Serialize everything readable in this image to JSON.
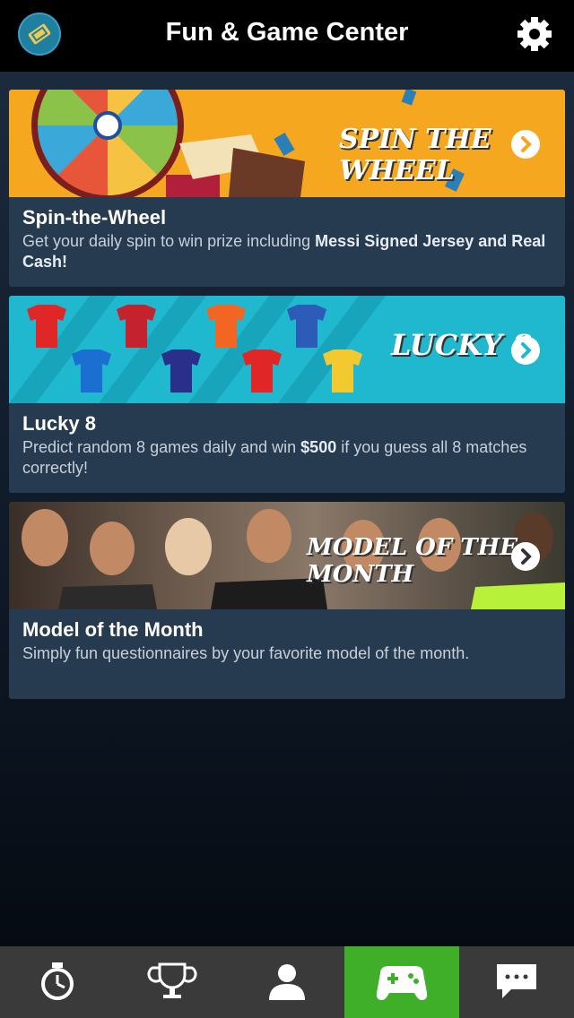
{
  "header": {
    "title": "Fun & Game Center",
    "logo_icon": "ticket-logo-icon",
    "settings_icon": "gear-icon"
  },
  "cards": [
    {
      "title": "Spin-the-Wheel",
      "desc_plain": "Get your daily spin to win prize including ",
      "desc_bold": "Messi Signed Jersey and Real Cash!",
      "banner_text": "SPIN THE WHEEL",
      "banner_color": "#f5a71f"
    },
    {
      "title": "Lucky 8",
      "desc_plain": "Predict random 8 games daily and win ",
      "desc_bold": "$500",
      "desc_tail": " if you guess all 8 matches correctly!",
      "banner_text": "LUCKY 8",
      "banner_color": "#1fb8cf"
    },
    {
      "title": "Model of the Month",
      "desc_plain": "Simply fun questionnaires by your favorite model of the month.",
      "banner_text": "MODEL OF THE MONTH",
      "banner_color": "#4a3c32"
    }
  ],
  "tabbar": {
    "tabs": [
      {
        "icon": "stopwatch-icon"
      },
      {
        "icon": "trophy-icon"
      },
      {
        "icon": "profile-icon"
      },
      {
        "icon": "gamepad-icon",
        "active": true
      },
      {
        "icon": "chat-icon"
      }
    ],
    "active_color": "#3fae29"
  }
}
